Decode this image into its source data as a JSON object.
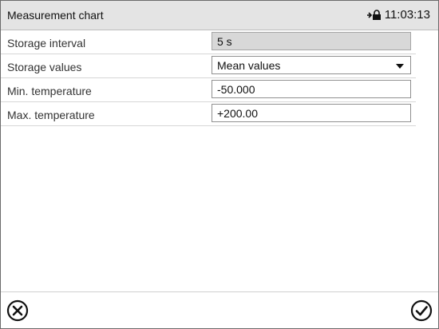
{
  "header": {
    "title": "Measurement chart",
    "status_icon": "door-lock-icon",
    "time": "11:03:13"
  },
  "settings": {
    "storage_interval": {
      "label": "Storage interval",
      "value": "5 s"
    },
    "storage_values": {
      "label": "Storage values",
      "value": "Mean values"
    },
    "min_temperature": {
      "label": "Min. temperature",
      "value": "-50.000"
    },
    "max_temperature": {
      "label": "Max. temperature",
      "value": "+200.00"
    }
  },
  "footer": {
    "cancel_icon": "close-circle-icon",
    "confirm_icon": "check-circle-icon"
  }
}
